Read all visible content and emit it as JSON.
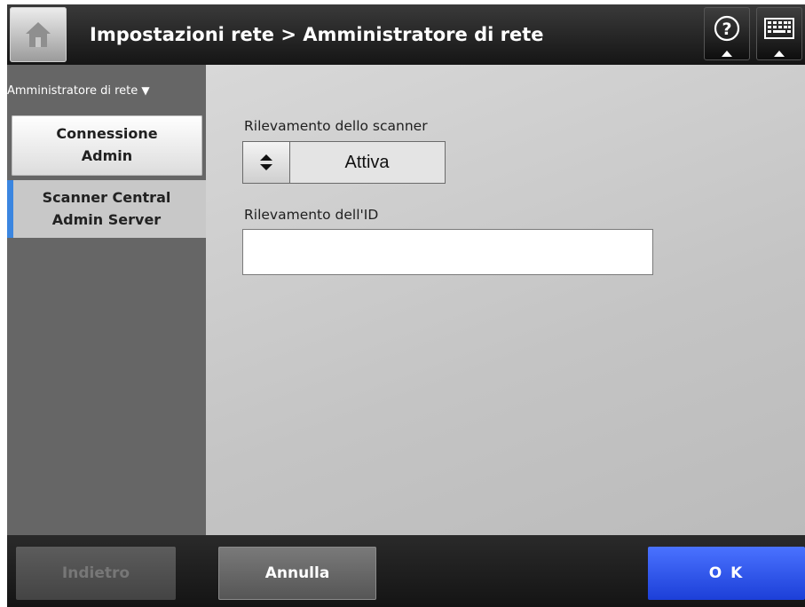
{
  "header": {
    "title": "Impostazioni rete > Amministratore di rete",
    "home_icon": "home-icon",
    "help_icon": "question-mark-icon",
    "keyboard_icon": "keyboard-icon"
  },
  "sidebar": {
    "group_label": "Amministratore di rete",
    "group_arrow": "▼",
    "items": [
      {
        "label": "Connessione Admin",
        "selected": false
      },
      {
        "label": "Scanner Central Admin Server",
        "selected": true
      }
    ]
  },
  "main": {
    "scanner_detection_label": "Rilevamento dello scanner",
    "scanner_detection_value": "Attiva",
    "id_detection_label": "Rilevamento dell'ID",
    "id_detection_value": ""
  },
  "footer": {
    "back_label": "Indietro",
    "cancel_label": "Annulla",
    "ok_label": "O K"
  },
  "colors": {
    "accent_blue": "#3b86e0",
    "ok_button": "#1c3fd8",
    "sidebar_bg": "#666666",
    "header_bg": "#151515"
  }
}
